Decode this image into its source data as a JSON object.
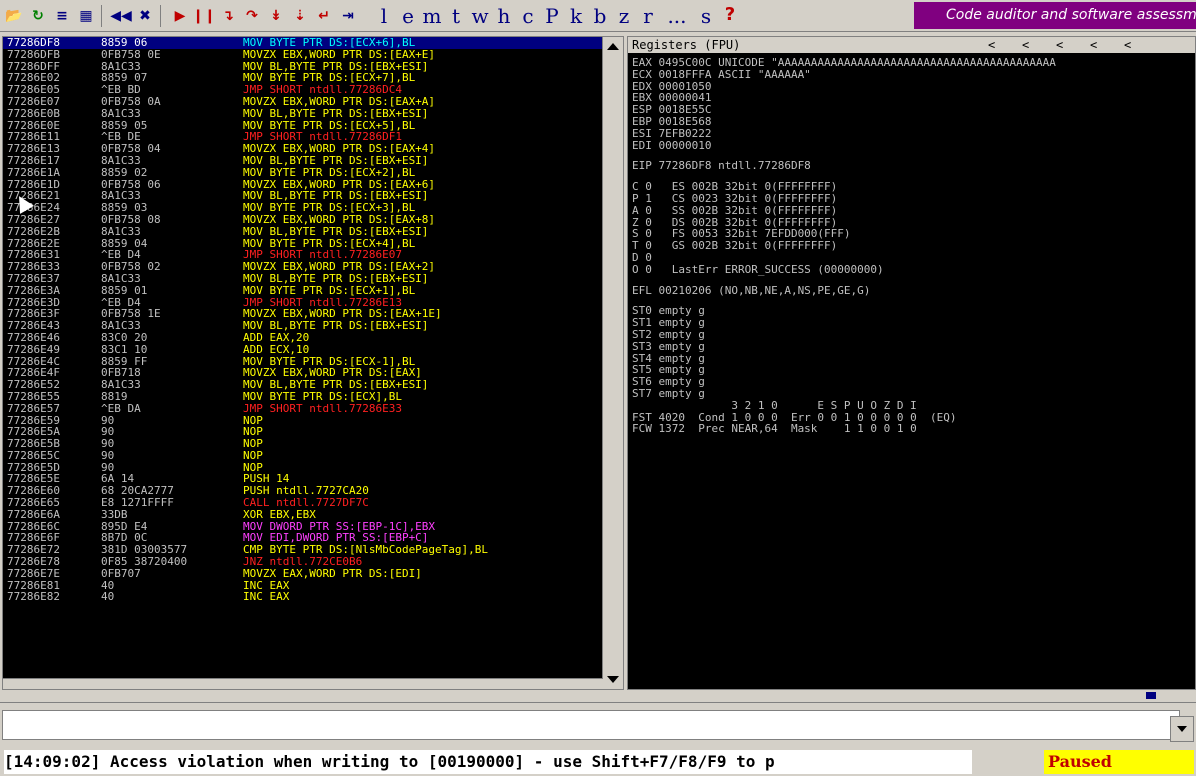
{
  "toolbar": {
    "icons": [
      "open-folder-icon",
      "restart-icon",
      "log-icon",
      "memory-icon",
      "rewind-icon",
      "close-program-icon",
      "run-icon",
      "pause-icon",
      "step-into-icon",
      "step-over-icon",
      "trace-into-icon",
      "trace-over-icon",
      "execute-till-return-icon",
      "goto-icon"
    ],
    "letters": [
      "l",
      "e",
      "m",
      "t",
      "w",
      "h",
      "c",
      "P",
      "k",
      "b",
      "z",
      "r",
      "...",
      "s",
      "?"
    ],
    "banner": "Code auditor and software assessment specialist"
  },
  "disasm": {
    "rows": [
      {
        "addr": "77286DF8",
        "hex": "8859 06",
        "mn": "MOV BYTE PTR DS:[ECX+6],BL",
        "color": "#00ffff",
        "sel": true
      },
      {
        "addr": "77286DFB",
        "hex": "0FB758 0E",
        "mn": "MOVZX EBX,WORD PTR DS:[EAX+E]",
        "color": "#ffff00"
      },
      {
        "addr": "77286DFF",
        "hex": "8A1C33",
        "mn": "MOV BL,BYTE PTR DS:[EBX+ESI]",
        "color": "#ffff00"
      },
      {
        "addr": "77286E02",
        "hex": "8859 07",
        "mn": "MOV BYTE PTR DS:[ECX+7],BL",
        "color": "#ffff00"
      },
      {
        "addr": "77286E05",
        "hex": "^EB BD",
        "mn": "JMP SHORT ntdll.77286DC4",
        "color": "#ff2020",
        "jmp": true
      },
      {
        "addr": "77286E07",
        "hex": "0FB758 0A",
        "mn": "MOVZX EBX,WORD PTR DS:[EAX+A]",
        "color": "#ffff00"
      },
      {
        "addr": "77286E0B",
        "hex": "8A1C33",
        "mn": "MOV BL,BYTE PTR DS:[EBX+ESI]",
        "color": "#ffff00"
      },
      {
        "addr": "77286E0E",
        "hex": "8859 05",
        "mn": "MOV BYTE PTR DS:[ECX+5],BL",
        "color": "#ffff00"
      },
      {
        "addr": "77286E11",
        "hex": "^EB DE",
        "mn": "JMP SHORT ntdll.77286DF1",
        "color": "#ff2020",
        "jmp": true
      },
      {
        "addr": "77286E13",
        "hex": "0FB758 04",
        "mn": "MOVZX EBX,WORD PTR DS:[EAX+4]",
        "color": "#ffff00"
      },
      {
        "addr": "77286E17",
        "hex": "8A1C33",
        "mn": "MOV BL,BYTE PTR DS:[EBX+ESI]",
        "color": "#ffff00"
      },
      {
        "addr": "77286E1A",
        "hex": "8859 02",
        "mn": "MOV BYTE PTR DS:[ECX+2],BL",
        "color": "#ffff00"
      },
      {
        "addr": "77286E1D",
        "hex": "0FB758 06",
        "mn": "MOVZX EBX,WORD PTR DS:[EAX+6]",
        "color": "#ffff00"
      },
      {
        "addr": "77286E21",
        "hex": "8A1C33",
        "mn": "MOV BL,BYTE PTR DS:[EBX+ESI]",
        "color": "#ffff00"
      },
      {
        "addr": "77286E24",
        "hex": "8859 03",
        "mn": "MOV BYTE PTR DS:[ECX+3],BL",
        "color": "#ffff00"
      },
      {
        "addr": "77286E27",
        "hex": "0FB758 08",
        "mn": "MOVZX EBX,WORD PTR DS:[EAX+8]",
        "color": "#ffff00"
      },
      {
        "addr": "77286E2B",
        "hex": "8A1C33",
        "mn": "MOV BL,BYTE PTR DS:[EBX+ESI]",
        "color": "#ffff00"
      },
      {
        "addr": "77286E2E",
        "hex": "8859 04",
        "mn": "MOV BYTE PTR DS:[ECX+4],BL",
        "color": "#ffff00"
      },
      {
        "addr": "77286E31",
        "hex": "^EB D4",
        "mn": "JMP SHORT ntdll.77286E07",
        "color": "#ff2020",
        "jmp": true
      },
      {
        "addr": "77286E33",
        "hex": "0FB758 02",
        "mn": "MOVZX EBX,WORD PTR DS:[EAX+2]",
        "color": "#ffff00"
      },
      {
        "addr": "77286E37",
        "hex": "8A1C33",
        "mn": "MOV BL,BYTE PTR DS:[EBX+ESI]",
        "color": "#ffff00"
      },
      {
        "addr": "77286E3A",
        "hex": "8859 01",
        "mn": "MOV BYTE PTR DS:[ECX+1],BL",
        "color": "#ffff00"
      },
      {
        "addr": "77286E3D",
        "hex": "^EB D4",
        "mn": "JMP SHORT ntdll.77286E13",
        "color": "#ff2020",
        "jmp": true
      },
      {
        "addr": "77286E3F",
        "hex": "0FB758 1E",
        "mn": "MOVZX EBX,WORD PTR DS:[EAX+1E]",
        "color": "#ffff00"
      },
      {
        "addr": "77286E43",
        "hex": "8A1C33",
        "mn": "MOV BL,BYTE PTR DS:[EBX+ESI]",
        "color": "#ffff00"
      },
      {
        "addr": "77286E46",
        "hex": "83C0 20",
        "mn": "ADD EAX,20",
        "color": "#ffff00"
      },
      {
        "addr": "77286E49",
        "hex": "83C1 10",
        "mn": "ADD ECX,10",
        "color": "#ffff00"
      },
      {
        "addr": "77286E4C",
        "hex": "8859 FF",
        "mn": "MOV BYTE PTR DS:[ECX-1],BL",
        "color": "#ffff00"
      },
      {
        "addr": "77286E4F",
        "hex": "0FB718",
        "mn": "MOVZX EBX,WORD PTR DS:[EAX]",
        "color": "#ffff00"
      },
      {
        "addr": "77286E52",
        "hex": "8A1C33",
        "mn": "MOV BL,BYTE PTR DS:[EBX+ESI]",
        "color": "#ffff00"
      },
      {
        "addr": "77286E55",
        "hex": "8819",
        "mn": "MOV BYTE PTR DS:[ECX],BL",
        "color": "#ffff00"
      },
      {
        "addr": "77286E57",
        "hex": "^EB DA",
        "mn": "JMP SHORT ntdll.77286E33",
        "color": "#ff2020",
        "jmp": true
      },
      {
        "addr": "77286E59",
        "hex": "90",
        "mn": "NOP",
        "color": "#ffff00"
      },
      {
        "addr": "77286E5A",
        "hex": "90",
        "mn": "NOP",
        "color": "#ffff00"
      },
      {
        "addr": "77286E5B",
        "hex": "90",
        "mn": "NOP",
        "color": "#ffff00"
      },
      {
        "addr": "77286E5C",
        "hex": "90",
        "mn": "NOP",
        "color": "#ffff00"
      },
      {
        "addr": "77286E5D",
        "hex": "90",
        "mn": "NOP",
        "color": "#ffff00"
      },
      {
        "addr": "77286E5E",
        "hex": "6A 14",
        "mn": "PUSH 14",
        "color": "#ffff00"
      },
      {
        "addr": "77286E60",
        "hex": "68 20CA2777",
        "mn": "PUSH ntdll.7727CA20",
        "color": "#ffff00"
      },
      {
        "addr": "77286E65",
        "hex": "E8 1271FFFF",
        "mn": "CALL ntdll.7727DF7C",
        "color": "#ff2020",
        "jmp": true
      },
      {
        "addr": "77286E6A",
        "hex": "33DB",
        "mn": "XOR EBX,EBX",
        "color": "#ffff00"
      },
      {
        "addr": "77286E6C",
        "hex": "895D E4",
        "mn": "MOV DWORD PTR SS:[EBP-1C],EBX",
        "color": "#ff40ff"
      },
      {
        "addr": "77286E6F",
        "hex": "8B7D 0C",
        "mn": "MOV EDI,DWORD PTR SS:[EBP+C]",
        "color": "#ff40ff"
      },
      {
        "addr": "77286E72",
        "hex": "381D 03003577",
        "mn": "CMP BYTE PTR DS:[NlsMbCodePageTag],BL",
        "color": "#ffff00"
      },
      {
        "addr": "77286E78",
        "hex": "0F85 38720400",
        "mn": "JNZ ntdll.772CE0B6",
        "color": "#ff2020",
        "jmp": true
      },
      {
        "addr": "77286E7E",
        "hex": "0FB707",
        "mn": "MOVZX EAX,WORD PTR DS:[EDI]",
        "color": "#ffff00"
      },
      {
        "addr": "77286E81",
        "hex": "40",
        "mn": "INC EAX",
        "color": "#ffff00"
      },
      {
        "addr": "77286E82",
        "hex": "40",
        "mn": "INC EAX",
        "color": "#ffff00"
      }
    ]
  },
  "registers": {
    "header": "Registers (FPU)",
    "arrows": [
      "<",
      "<",
      "<",
      "<",
      "<"
    ],
    "lines": [
      "EAX 0495C00C UNICODE \"AAAAAAAAAAAAAAAAAAAAAAAAAAAAAAAAAAAAAAAAAA",
      "ECX 0018FFFA ASCII \"AAAAAA\"",
      "EDX 00001050",
      "EBX 00000041",
      "ESP 0018E55C",
      "EBP 0018E568",
      "ESI 7EFB0222",
      "EDI 00000010",
      "",
      "EIP 77286DF8 ntdll.77286DF8",
      "",
      "C 0   ES 002B 32bit 0(FFFFFFFF)",
      "P 1   CS 0023 32bit 0(FFFFFFFF)",
      "A 0   SS 002B 32bit 0(FFFFFFFF)",
      "Z 0   DS 002B 32bit 0(FFFFFFFF)",
      "S 0   FS 0053 32bit 7EFDD000(FFF)",
      "T 0   GS 002B 32bit 0(FFFFFFFF)",
      "D 0",
      "O 0   LastErr ERROR_SUCCESS (00000000)",
      "",
      "EFL 00210206 (NO,NB,NE,A,NS,PE,GE,G)",
      "",
      "ST0 empty g",
      "ST1 empty g",
      "ST2 empty g",
      "ST3 empty g",
      "ST4 empty g",
      "ST5 empty g",
      "ST6 empty g",
      "ST7 empty g",
      "               3 2 1 0      E S P U O Z D I",
      "FST 4020  Cond 1 0 0 0  Err 0 0 1 0 0 0 0 0  (EQ)",
      "FCW 1372  Prec NEAR,64  Mask    1 1 0 0 1 0"
    ]
  },
  "status": {
    "message": "[14:09:02] Access violation when writing to [00190000] - use Shift+F7/F8/F9 to p",
    "state": "Paused"
  }
}
